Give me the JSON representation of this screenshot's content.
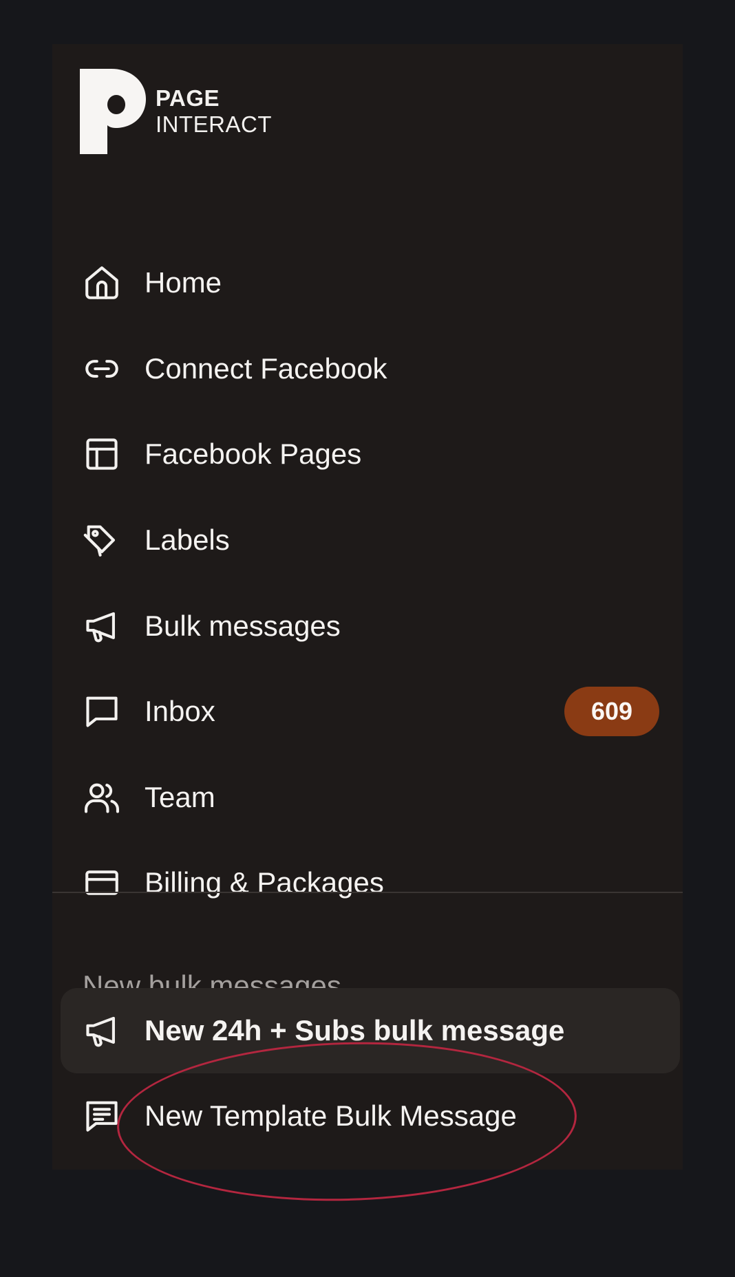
{
  "brand": {
    "line1": "PAGE",
    "line2": "INTERACT",
    "logo_icon": "page-interact-logo-icon"
  },
  "nav": {
    "items": [
      {
        "label": "Home",
        "icon": "home-icon"
      },
      {
        "label": "Connect Facebook",
        "icon": "link-icon"
      },
      {
        "label": "Facebook Pages",
        "icon": "layout-icon"
      },
      {
        "label": "Labels",
        "icon": "tags-icon"
      },
      {
        "label": "Bulk messages",
        "icon": "megaphone-icon"
      },
      {
        "label": "Inbox",
        "icon": "message-square-icon",
        "badge": "609"
      },
      {
        "label": "Team",
        "icon": "users-icon"
      },
      {
        "label": "Billing & Packages",
        "icon": "credit-card-icon"
      }
    ]
  },
  "section": {
    "title": "New bulk messages",
    "items": [
      {
        "label": "New 24h + Subs bulk message",
        "icon": "megaphone-icon",
        "active": true
      },
      {
        "label": "New Template Bulk Message",
        "icon": "message-text-icon",
        "active": false
      }
    ]
  },
  "colors": {
    "page_background": "#16171b",
    "sidebar_background": "#1e1a19",
    "active_item_background": "#2a2624",
    "badge_background": "#8a3b14",
    "annotation_circle": "#b3263f",
    "text_primary": "#f5f3f1",
    "text_muted": "#a4a09e"
  }
}
